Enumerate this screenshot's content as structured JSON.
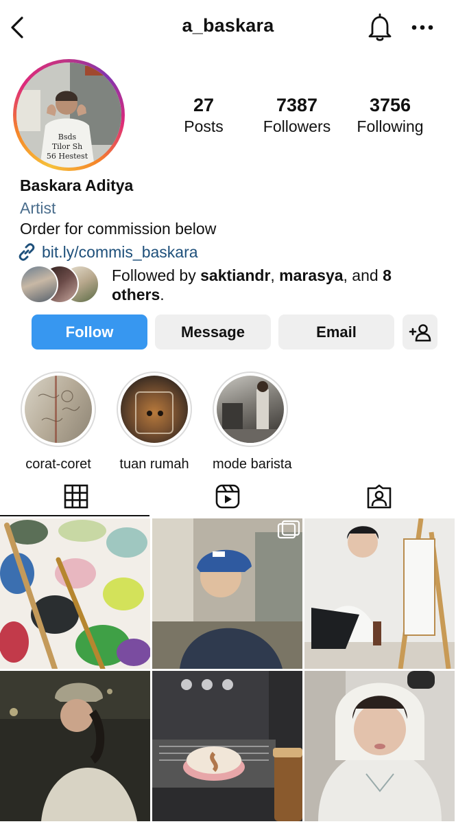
{
  "header": {
    "username": "a_baskara",
    "back_icon": "chevron-left-icon",
    "notification_icon": "bell-icon",
    "more_icon": "more-horizontal-icon"
  },
  "stats": {
    "posts_count": "27",
    "posts_label": "Posts",
    "followers_count": "7387",
    "followers_label": "Followers",
    "following_count": "3756",
    "following_label": "Following"
  },
  "profile": {
    "name": "Baskara Aditya",
    "category": "Artist",
    "bio": "Order for commission below",
    "link": "bit.ly/commis_baskara"
  },
  "followed_by": {
    "prefix": "Followed by ",
    "user1": "saktiandr",
    "sep1": ", ",
    "user2": "marasya",
    "mid": ", and ",
    "others": "8 others",
    "suffix": "."
  },
  "actions": {
    "follow": "Follow",
    "message": "Message",
    "email": "Email",
    "add_user_icon": "add-person-icon"
  },
  "highlights": [
    {
      "label": "corat-coret"
    },
    {
      "label": "tuan rumah"
    },
    {
      "label": "mode barista"
    }
  ],
  "tabs": [
    {
      "name": "posts-grid",
      "icon": "grid-icon",
      "active": true
    },
    {
      "name": "reels",
      "icon": "reels-icon",
      "active": false
    },
    {
      "name": "tagged",
      "icon": "tagged-person-icon",
      "active": false
    }
  ],
  "posts": [
    {
      "subject": "paint palette with brushes"
    },
    {
      "subject": "child in cap, multiple-photo post"
    },
    {
      "subject": "painting at easel"
    },
    {
      "subject": "person in cap at night"
    },
    {
      "subject": "espresso machine latte art"
    },
    {
      "subject": "portrait in white hoodie"
    }
  ],
  "colors": {
    "accent": "#3797f0",
    "secondary_button": "#efefef",
    "link": "#1d4f7a",
    "category": "#4a6d8c"
  }
}
